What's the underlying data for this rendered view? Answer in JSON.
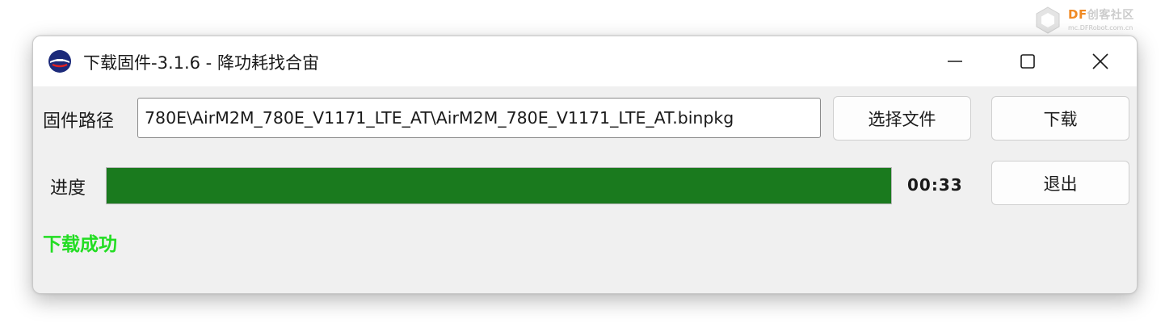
{
  "watermark": {
    "brand_prefix": "DF",
    "brand_suffix": "创客社区",
    "url": "mc.DFRobot.com.cn",
    "brand_color": "#f08a24"
  },
  "window": {
    "title": "下载固件-3.1.6 - 降功耗找合宙",
    "app_icon": "luat-logo-icon",
    "controls": {
      "minimize": "minimize-icon",
      "maximize": "maximize-icon",
      "close": "close-icon"
    }
  },
  "firmware": {
    "path_label": "固件路径",
    "path_value": "780E\\AirM2M_780E_V1171_LTE_AT\\AirM2M_780E_V1171_LTE_AT.binpkg",
    "choose_file_label": "选择文件",
    "download_label": "下载"
  },
  "progress": {
    "label": "进度",
    "value_percent": 100,
    "elapsed": "00:33",
    "bar_color": "#1a7a1e",
    "exit_label": "退出"
  },
  "status": {
    "message": "下载成功",
    "color": "#22dd22"
  }
}
